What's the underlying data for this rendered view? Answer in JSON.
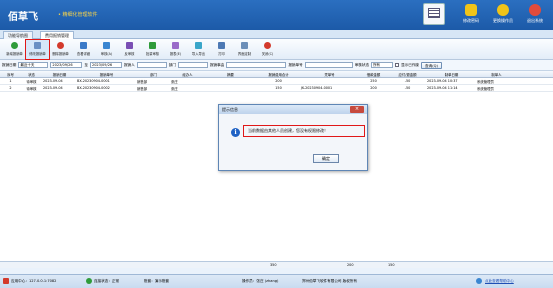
{
  "app": {
    "logo": "佰草飞",
    "subtitle": "• 精细化管理软件"
  },
  "top_actions": [
    {
      "label": "修改密码",
      "color": "#f0c419",
      "icon": "lock-icon"
    },
    {
      "label": "更换操作员",
      "color": "#f0c419",
      "icon": "user-icon"
    },
    {
      "label": "退出系统",
      "color": "#e24b3b",
      "icon": "power-icon"
    }
  ],
  "tabs": [
    "功能导航图",
    "费用报销管理"
  ],
  "toolbar": [
    {
      "label": "新增报销单",
      "color": "#2f9b3a"
    },
    {
      "label": "修改报销单",
      "color": "#6a8fc4"
    },
    {
      "label": "删除报销单",
      "color": "#d33a2c"
    },
    {
      "label": "查看详细",
      "color": "#3a7ac8"
    },
    {
      "label": "审核(A)",
      "color": "#3a86d1"
    },
    {
      "label": "反审核",
      "color": "#7a4fb4"
    },
    {
      "label": "批量审核",
      "color": "#2f9b3a"
    },
    {
      "label": "报表(E)",
      "color": "#9a6bc9"
    },
    {
      "label": "导入导出",
      "color": "#3aa6c9"
    },
    {
      "label": "打印",
      "color": "#4d79b4"
    },
    {
      "label": "界面定制",
      "color": "#6c8fb8"
    },
    {
      "label": "关闭(C)",
      "color": "#d33a2c"
    }
  ],
  "filter": {
    "date_label": "报销日期",
    "period": "最近十天",
    "date_from": "2023/09/26",
    "to_label": "至",
    "date_to": "2023/09/26",
    "handler_label": "报销人",
    "dept_label": "部门",
    "remark_label": "报销事由",
    "voucher_label": "报销单号",
    "status_label": "审核状态",
    "status_value": "所有",
    "show_deleted": "显示已作废",
    "query_button": "查询(Q)"
  },
  "table": {
    "columns": [
      "序号",
      "状态",
      "报销日期",
      "报销单号",
      "部门",
      "经办人",
      "摘要",
      "报销费用合计",
      "凭单号",
      "借款金额",
      "应付/退金额",
      "制单日期",
      "制单人"
    ],
    "rows": [
      [
        "1",
        "待审核",
        "2023-09-04",
        "BX-20230904-0001",
        "销售部",
        "张庄",
        "",
        "200",
        "",
        "250",
        "-50",
        "2023-09-04 10:37",
        "系统管理员"
      ],
      [
        "2",
        "待审核",
        "2023-09-04",
        "BX-20230904-0002",
        "销售部",
        "张庄",
        "",
        "150",
        "JK-20230904-0001",
        "200",
        "-50",
        "2023-09-04 11:14",
        "系统管理员"
      ]
    ],
    "totals": {
      "fee": "350",
      "loan": "200",
      "refund": "150"
    }
  },
  "dialog": {
    "title": "提示信息",
    "close": "×",
    "message": "当前数据由其他人员创建，您没有权限修改！",
    "ok": "确定"
  },
  "status_bar": {
    "server": "应用中心：127.0.0.1:7082",
    "connection": "连接状态：正常",
    "account": "账套：演示账套",
    "operator": "操作员：张庄 (zhang)",
    "copyright": "郑州佰草飞软件有限公司 版权所有",
    "help": "点此查看帮助中心"
  }
}
